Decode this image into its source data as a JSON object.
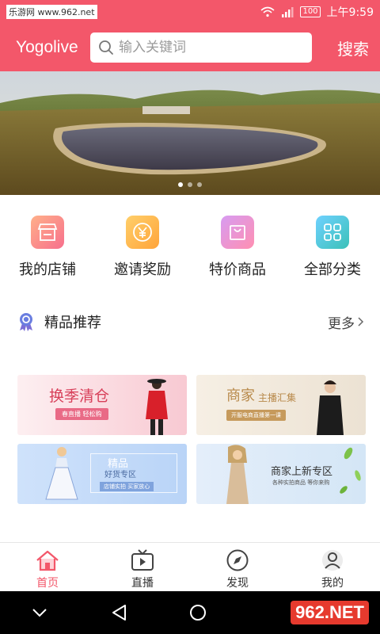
{
  "status_bar": {
    "watermark": "乐游网 www.962.net",
    "battery": "100",
    "time": "上午9:59"
  },
  "header": {
    "brand": "Yogolive",
    "search_placeholder": "输入关键词",
    "search_button": "搜索"
  },
  "banner": {
    "slide_count": 3,
    "active_index": 0
  },
  "quick_nav": [
    {
      "label": "我的店铺",
      "icon": "storefront-icon",
      "color_from": "#ffb08a",
      "color_to": "#f76f8c"
    },
    {
      "label": "邀请奖励",
      "icon": "yuan-coin-icon",
      "color_from": "#ffcf6a",
      "color_to": "#ffa43a"
    },
    {
      "label": "特价商品",
      "icon": "shopping-bag-icon",
      "color_from": "#d79cf2",
      "color_to": "#ff8fb1"
    },
    {
      "label": "全部分类",
      "icon": "category-grid-icon",
      "color_from": "#6fd1ff",
      "color_to": "#3bc1b8"
    }
  ],
  "featured": {
    "title": "精品推荐",
    "more": "更多"
  },
  "promos": [
    {
      "title": "换季清仓",
      "subtitle": "春直播 轻松购"
    },
    {
      "title": "商家",
      "title2": "主播汇集",
      "subtitle": "开服电商直播第一课"
    },
    {
      "title": "精品",
      "title2": "好货专区",
      "subtitle": "店铺实拍 买家放心"
    },
    {
      "title": "商家上新专区",
      "subtitle": "各种实拍商品 等你来购"
    }
  ],
  "tab_bar": [
    {
      "label": "首页",
      "icon": "home-icon",
      "active": true
    },
    {
      "label": "直播",
      "icon": "tv-icon",
      "active": false
    },
    {
      "label": "发现",
      "icon": "compass-icon",
      "active": false
    },
    {
      "label": "我的",
      "icon": "user-icon",
      "active": false
    }
  ],
  "watermark_bottom": "962.NET"
}
